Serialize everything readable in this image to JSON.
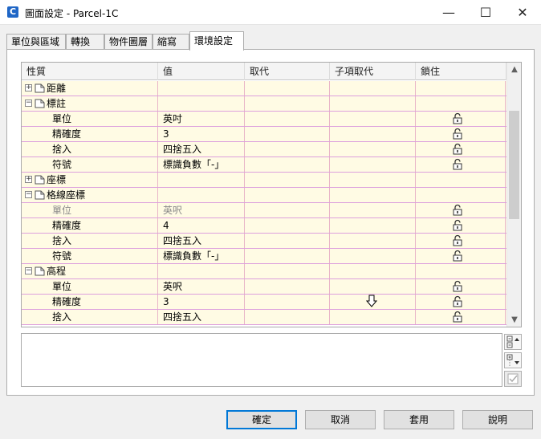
{
  "window": {
    "title": "圖面設定 - Parcel-1C",
    "app_icon_letter": "C",
    "min_glyph": "—",
    "max_glyph": "☐",
    "close_glyph": "✕"
  },
  "tabs": [
    {
      "label": "單位與區域",
      "active": false
    },
    {
      "label": "轉換",
      "active": false
    },
    {
      "label": "物件圖層",
      "active": false
    },
    {
      "label": "縮寫",
      "active": false
    },
    {
      "label": "環境設定",
      "active": true
    }
  ],
  "grid": {
    "columns": [
      "性質",
      "值",
      "取代",
      "子項取代",
      "鎖住"
    ],
    "rows": [
      {
        "type": "group",
        "label": "距離",
        "expanded": false
      },
      {
        "type": "group",
        "label": "標註",
        "expanded": true
      },
      {
        "type": "prop",
        "label": "單位",
        "value": "英吋",
        "locked": true,
        "dim": false
      },
      {
        "type": "prop",
        "label": "精確度",
        "value": "3",
        "locked": true,
        "dim": false
      },
      {
        "type": "prop",
        "label": "捨入",
        "value": "四捨五入",
        "locked": true,
        "dim": false
      },
      {
        "type": "prop",
        "label": "符號",
        "value": "標識負數「-」",
        "locked": true,
        "dim": false
      },
      {
        "type": "group",
        "label": "座標",
        "expanded": false
      },
      {
        "type": "group",
        "label": "格線座標",
        "expanded": true
      },
      {
        "type": "prop",
        "label": "單位",
        "value": "英呎",
        "locked": true,
        "dim": true
      },
      {
        "type": "prop",
        "label": "精確度",
        "value": "4",
        "locked": true,
        "dim": false
      },
      {
        "type": "prop",
        "label": "捨入",
        "value": "四捨五入",
        "locked": true,
        "dim": false
      },
      {
        "type": "prop",
        "label": "符號",
        "value": "標識負數「-」",
        "locked": true,
        "dim": false
      },
      {
        "type": "group",
        "label": "高程",
        "expanded": true
      },
      {
        "type": "prop",
        "label": "單位",
        "value": "英呎",
        "locked": true,
        "dim": false
      },
      {
        "type": "prop",
        "label": "精確度",
        "value": "3",
        "locked": true,
        "dim": false
      },
      {
        "type": "prop",
        "label": "捨入",
        "value": "四捨五入",
        "locked": true,
        "dim": false
      }
    ]
  },
  "buttons": {
    "ok": "確定",
    "cancel": "取消",
    "apply": "套用",
    "help": "說明"
  }
}
